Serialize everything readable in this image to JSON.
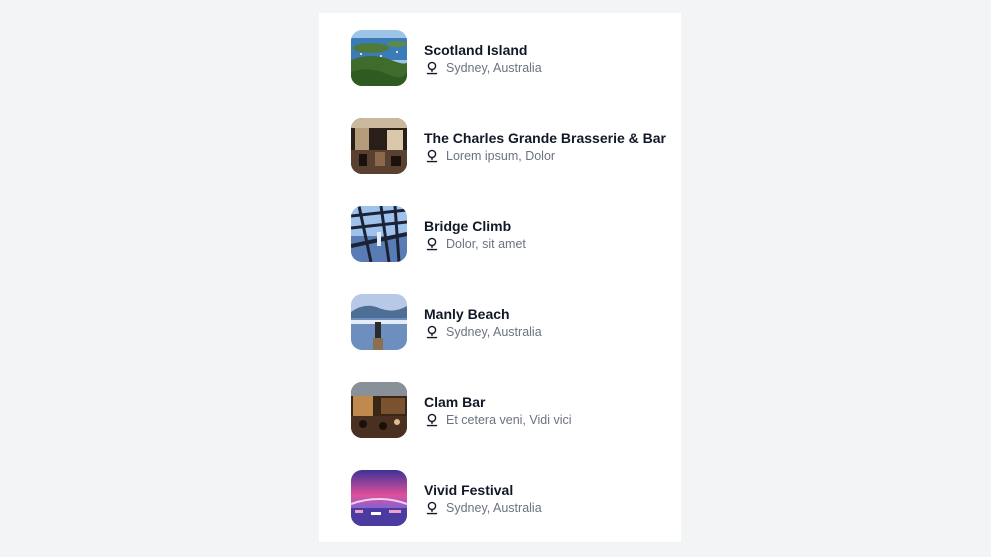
{
  "places": [
    {
      "title": "Scotland Island",
      "location": "Sydney, Australia",
      "thumb": "scotland-island-photo",
      "palette": [
        "#5f9fd6",
        "#2f6a9b",
        "#3f6b2c",
        "#7aa04d"
      ]
    },
    {
      "title": "The Charles Grande Brasserie & Bar",
      "location": "Lorem ipsum, Dolor",
      "thumb": "brasserie-interior-photo",
      "palette": [
        "#3a2a20",
        "#8a6a4a",
        "#d8c9b0",
        "#1e1712"
      ]
    },
    {
      "title": "Bridge Climb",
      "location": "Dolor, sit amet",
      "thumb": "bridge-climb-photo",
      "palette": [
        "#8ab4e8",
        "#1b2c48",
        "#4a6ea8",
        "#c9d6ec"
      ]
    },
    {
      "title": "Manly Beach",
      "location": "Sydney, Australia",
      "thumb": "manly-beach-photo",
      "palette": [
        "#9cb6dc",
        "#4e6e96",
        "#2c4466",
        "#c7d3e6"
      ]
    },
    {
      "title": "Clam Bar",
      "location": "Et cetera veni, Vidi vici",
      "thumb": "clam-bar-interior-photo",
      "palette": [
        "#5a3a22",
        "#b07a44",
        "#2a1a10",
        "#e0c08a"
      ]
    },
    {
      "title": "Vivid Festival",
      "location": "Sydney, Australia",
      "thumb": "vivid-festival-photo",
      "palette": [
        "#4b3aa0",
        "#e0509a",
        "#7d63d8",
        "#f2a0c8"
      ]
    }
  ],
  "icons": {
    "location": "map-pin-icon"
  }
}
